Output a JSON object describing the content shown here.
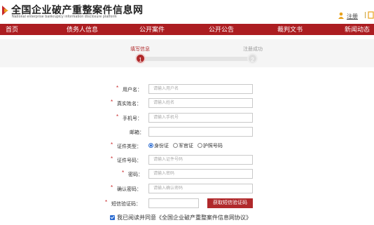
{
  "header": {
    "title": "全国企业破产重整案件信息网",
    "subtitle": "National enterprise bankruptcy information disclosure platform",
    "register_link": "注册"
  },
  "nav": {
    "items": [
      {
        "label": "首页"
      },
      {
        "label": "债务人信息"
      },
      {
        "label": "公开案件"
      },
      {
        "label": "公开公告"
      },
      {
        "label": "裁判文书"
      },
      {
        "label": "新闻动态"
      }
    ]
  },
  "steps": {
    "step1_label": "填写信息",
    "step1_number": "1",
    "step2_label": "注册成功",
    "step2_number": "2"
  },
  "form": {
    "required_mark": "*",
    "username": {
      "label": "用户名：",
      "placeholder": "请输入用户名"
    },
    "realname": {
      "label": "真实姓名：",
      "placeholder": "请输入姓名"
    },
    "phone": {
      "label": "手机号：",
      "placeholder": "请输入手机号"
    },
    "email": {
      "label": "邮箱：",
      "placeholder": ""
    },
    "id_type": {
      "label": "证件类型：",
      "options": [
        {
          "label": "身份证",
          "checked": true
        },
        {
          "label": "军官证",
          "checked": false
        },
        {
          "label": "护照号码",
          "checked": false
        }
      ]
    },
    "id_number": {
      "label": "证件号码：",
      "placeholder": "请输入证件号码"
    },
    "password": {
      "label": "密码：",
      "placeholder": "请输入密码"
    },
    "confirm_password": {
      "label": "确认密码：",
      "placeholder": "请输入确认密码"
    },
    "sms_code": {
      "label": "短信验证码：",
      "placeholder": "",
      "button": "获取短信验证码"
    },
    "agree_text": "我已阅读并同意《全国企业破产重整案件信息网协议》",
    "agree_checked": true
  },
  "colors": {
    "brand_red": "#ac1d21",
    "accent_blue": "#2a6bd1"
  }
}
